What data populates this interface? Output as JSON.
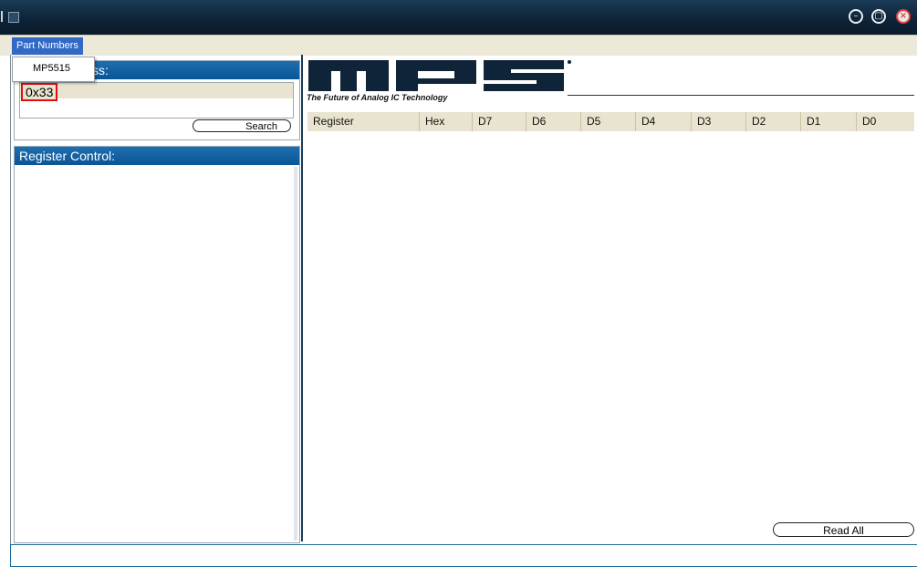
{
  "window": {
    "controls": [
      "minimize-icon",
      "maximize-icon",
      "close-icon"
    ]
  },
  "menu": {
    "part_numbers": "Part Numbers",
    "dropdown_items": [
      "MP5515"
    ]
  },
  "address_panel": {
    "title_suffix": "ss:",
    "selected_address": "0x33",
    "search_label": "Search"
  },
  "register_panel": {
    "title": "Register Control:"
  },
  "logo": {
    "text": "MPS",
    "tagline": "The Future of Analog IC Technology"
  },
  "table": {
    "columns": [
      "Register",
      "Hex",
      "D7",
      "D6",
      "D5",
      "D4",
      "D3",
      "D2",
      "D1",
      "D0"
    ]
  },
  "read_all_label": "Read All",
  "colors": {
    "titlebar": "#0f2438",
    "panel_header": "#0a5596",
    "menu_highlight": "#316ac5",
    "selection_highlight": "#e01010"
  }
}
